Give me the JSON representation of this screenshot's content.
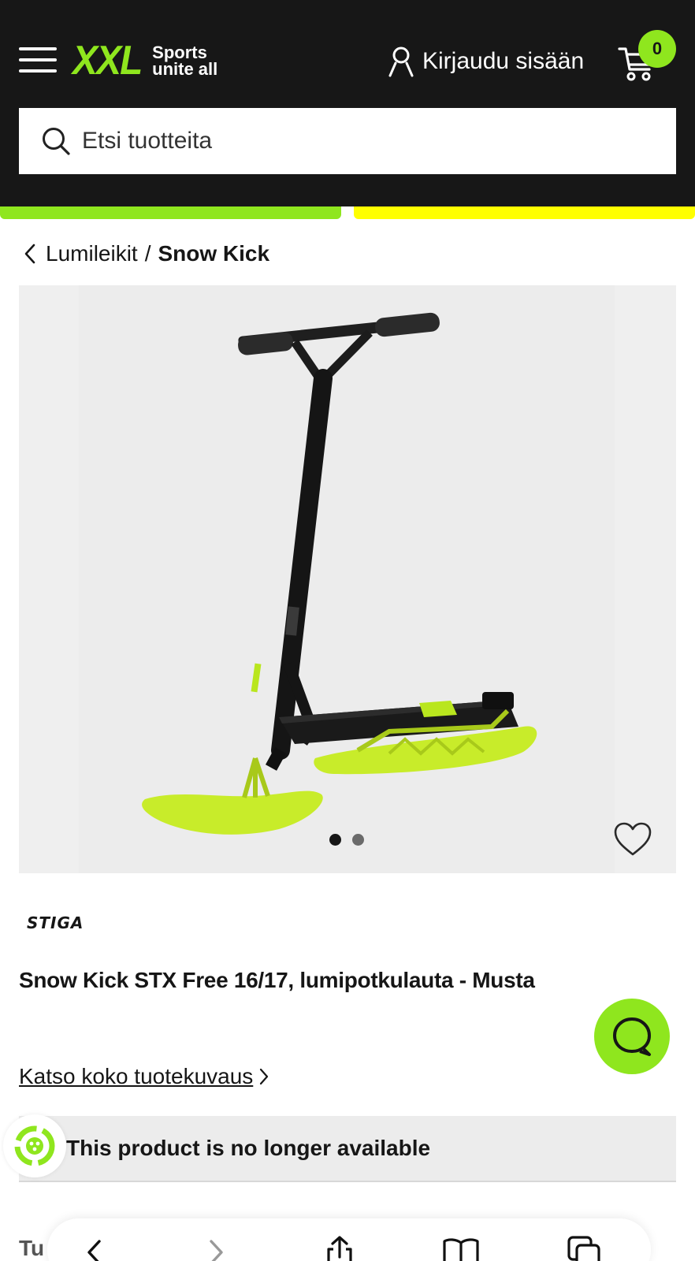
{
  "header": {
    "logo_text": "XXL",
    "logo_tagline": "Sports unite all",
    "login_label": "Kirjaudu sisään",
    "cart_count": "0"
  },
  "search": {
    "placeholder": "Etsi tuotteita"
  },
  "breadcrumb": {
    "parent": "Lumileikit",
    "separator": "/",
    "current": "Snow Kick"
  },
  "gallery": {
    "image_count": 2,
    "active_index": 0
  },
  "product": {
    "brand": "STIGA",
    "title": "Snow Kick STX Free 16/17, lumipotkulauta - Musta",
    "description_link": "Katso koko tuotekuvaus",
    "availability_message": "This product is no longer available"
  },
  "bottom_peek_text": "Tu",
  "colors": {
    "header_bg": "#171717",
    "accent_green": "#8fe61e",
    "accent_yellow": "#ffff00",
    "unavailable_bg": "#ececec"
  },
  "icons": {
    "menu": "hamburger-icon",
    "user": "user-icon",
    "cart": "cart-icon",
    "search": "search-icon",
    "back": "chevron-left-icon",
    "favorite": "heart-icon",
    "chat": "chat-icon",
    "eco": "eco-icon"
  }
}
